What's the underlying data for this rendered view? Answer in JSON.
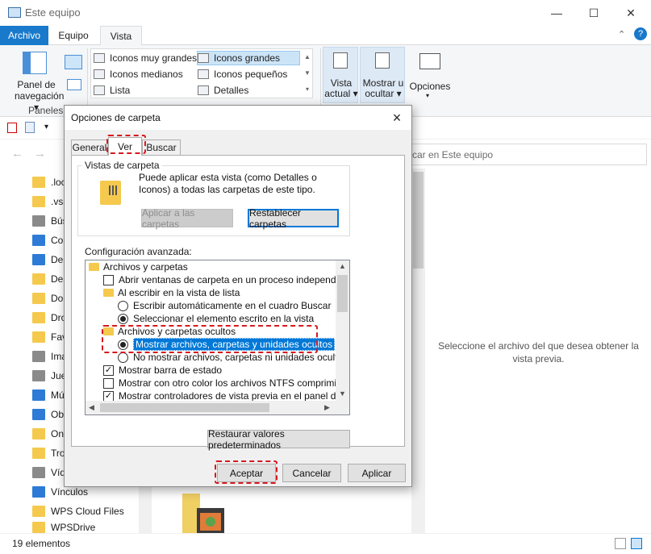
{
  "window": {
    "title": "Este equipo"
  },
  "ribbon": {
    "tabs": [
      "Archivo",
      "Equipo",
      "Vista"
    ],
    "panel_navegacion_label": [
      "Panel de",
      "navegación ▾"
    ],
    "group_paneles": "Paneles",
    "layout_items": [
      "Iconos muy grandes",
      "Iconos grandes",
      "Iconos medianos",
      "Iconos pequeños",
      "Lista",
      "Detalles"
    ],
    "vista_actual": [
      "Vista",
      "actual ▾"
    ],
    "mostrar_ocultar": [
      "Mostrar u",
      "ocultar ▾"
    ],
    "opciones": "Opciones"
  },
  "search": {
    "placeholder": "car en Este equipo"
  },
  "navpane": {
    "items": [
      ".loc",
      ".vsc",
      "Bús",
      "Co",
      "Des",
      "Des",
      "Do",
      "Dro",
      "Fav",
      "Ima",
      "Jue",
      "Mú",
      "Ob",
      "On",
      "Tro",
      "Víd",
      "Vínculos",
      "WPS Cloud Files",
      "WPSDrive"
    ]
  },
  "preview": {
    "message": "Seleccione el archivo del que desea obtener la vista previa."
  },
  "status": {
    "count": "19 elementos"
  },
  "dialog": {
    "title": "Opciones de carpeta",
    "tabs": {
      "general": "General",
      "ver": "Ver",
      "buscar": "Buscar"
    },
    "vistas_legend": "Vistas de carpeta",
    "vistas_desc": "Puede aplicar esta vista (como Detalles o Iconos) a todas las carpetas de este tipo.",
    "btn_aplicar_carpetas": "Aplicar a las carpetas",
    "btn_restablecer": "Restablecer carpetas",
    "config_label": "Configuración avanzada:",
    "tree": [
      {
        "kind": "folder",
        "label": "Archivos y carpetas"
      },
      {
        "kind": "checkbox",
        "checked": false,
        "label": "Abrir ventanas de carpeta  en un proceso independiente"
      },
      {
        "kind": "folder",
        "label": "Al escribir en la vista de lista"
      },
      {
        "kind": "radio",
        "checked": false,
        "label": "Escribir automáticamente en el cuadro Buscar"
      },
      {
        "kind": "radio",
        "checked": true,
        "label": "Seleccionar el elemento escrito en la vista"
      },
      {
        "kind": "folder",
        "label": "Archivos y carpetas ocultos"
      },
      {
        "kind": "radio",
        "checked": true,
        "label": "Mostrar archivos, carpetas y unidades ocultos"
      },
      {
        "kind": "radio",
        "checked": false,
        "label": "No mostrar archivos, carpetas ni unidades ocultos"
      },
      {
        "kind": "checkbox",
        "checked": true,
        "label": "Mostrar barra de estado"
      },
      {
        "kind": "checkbox",
        "checked": false,
        "label": "Mostrar con otro color los archivos NTFS comprimidos o c"
      },
      {
        "kind": "checkbox",
        "checked": true,
        "label": "Mostrar controladores de vista previa en el panel de vista"
      }
    ],
    "btn_restaurar": "Restaurar valores predeterminados",
    "btn_aceptar": "Aceptar",
    "btn_cancelar": "Cancelar",
    "btn_aplicar": "Aplicar"
  },
  "colors": {
    "accent": "#0078d7",
    "highlight_dash": "#d7181f",
    "archivo_tab": "#1979ca"
  }
}
